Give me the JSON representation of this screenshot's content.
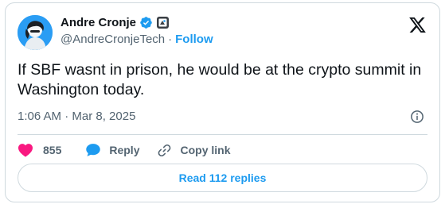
{
  "author": {
    "display_name": "Andre Cronje",
    "handle": "@AndreCronjeTech",
    "separator": "·",
    "follow_label": "Follow",
    "avatar_icon": "profile-avatar",
    "verified_icon": "verified-badge-icon",
    "affiliation_icon": "affiliation-badge-icon"
  },
  "tweet": {
    "text": "If SBF wasnt in prison, he would be at the crypto summit in Washington today.",
    "timestamp": "1:06 AM · Mar 8, 2025"
  },
  "actions": {
    "like_count": "855",
    "reply_label": "Reply",
    "copy_link_label": "Copy link"
  },
  "read_replies_label": "Read 112 replies",
  "colors": {
    "accent": "#1d9bf0",
    "like": "#f91880",
    "text": "#0f1419",
    "muted": "#536471",
    "border": "#cfd9de"
  }
}
